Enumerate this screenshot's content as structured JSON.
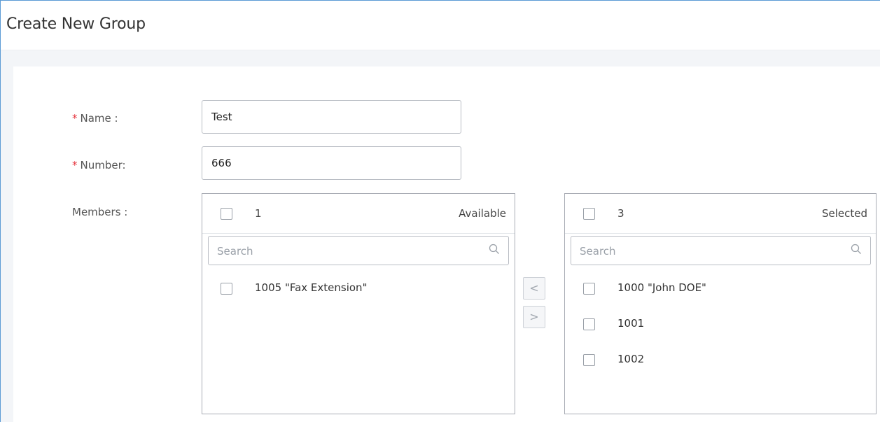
{
  "header": {
    "title": "Create New Group"
  },
  "form": {
    "name": {
      "label": "Name :",
      "value": "Test"
    },
    "number": {
      "label": "Number:",
      "value": "666"
    },
    "members": {
      "label": "Members :"
    }
  },
  "available": {
    "count": "1",
    "title": "Available",
    "search_placeholder": "Search",
    "items": [
      "1005 \"Fax Extension\""
    ]
  },
  "selected": {
    "count": "3",
    "title": "Selected",
    "search_placeholder": "Search",
    "items": [
      "1000 \"John DOE\"",
      "1001",
      "1002"
    ]
  },
  "transfer": {
    "left_label": "<",
    "right_label": ">"
  },
  "colors": {
    "required": "#e5323b",
    "accent_border": "#5b9bd5"
  }
}
